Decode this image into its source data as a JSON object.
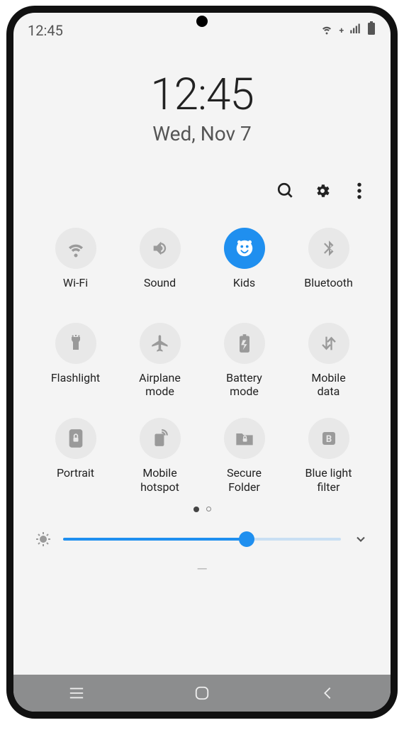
{
  "status": {
    "time": "12:45"
  },
  "header": {
    "time": "12:45",
    "date": "Wed, Nov 7"
  },
  "tiles": [
    {
      "label": "Wi-Fi"
    },
    {
      "label": "Sound"
    },
    {
      "label": "Kids"
    },
    {
      "label": "Bluetooth"
    },
    {
      "label": "Flashlight"
    },
    {
      "label": "Airplane\nmode"
    },
    {
      "label": "Battery\nmode"
    },
    {
      "label": "Mobile\ndata"
    },
    {
      "label": "Portrait"
    },
    {
      "label": "Mobile\nhotspot"
    },
    {
      "label": "Secure\nFolder"
    },
    {
      "label": "Blue light\nfilter"
    }
  ],
  "brightness": {
    "percent": 66
  },
  "pagination": {
    "current": 1,
    "total": 2
  }
}
